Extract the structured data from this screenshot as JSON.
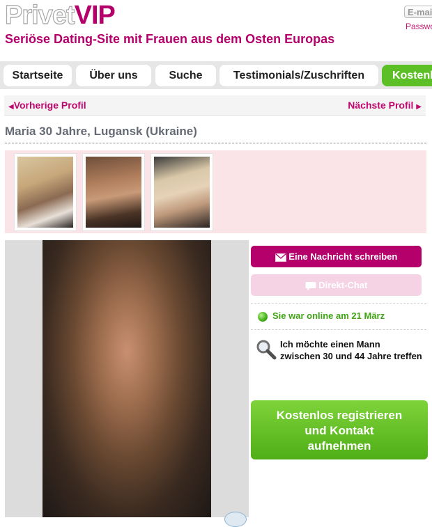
{
  "header": {
    "logo_part1": "Privet",
    "logo_part2": "VIP",
    "email_placeholder": "E-mail",
    "password_link": "Passwort",
    "tagline": "Seriöse Dating-Site mit Frauen aus dem Osten Europas"
  },
  "nav": {
    "tabs": [
      {
        "label": "Startseite"
      },
      {
        "label": "Über uns"
      },
      {
        "label": "Suche"
      },
      {
        "label": "Testimonials/Zuschriften"
      },
      {
        "label": "Kostenlos"
      }
    ]
  },
  "profile_nav": {
    "prev_label": "Vorherige Profil",
    "next_label": "Nächste Profil"
  },
  "profile": {
    "title": "Maria 30 Jahre, Lugansk (Ukraine)"
  },
  "actions": {
    "message_label": "Eine Nachricht schreiben",
    "chat_label": "Direkt-Chat",
    "online_status": "Sie war online am 21 März",
    "seeking_line1": "Ich möchte einen Mann",
    "seeking_line2": "zwischen 30 und 44 Jahre treffen",
    "register_line1": "Kostenlos registrieren",
    "register_line2": "und Kontakt",
    "register_line3": "aufnehmen"
  },
  "icons": [
    "envelope-icon",
    "chat-bubble-icon",
    "online-dot-icon",
    "magnifier-icon",
    "triangle-left-icon",
    "triangle-right-icon"
  ],
  "colors": {
    "brand": "#b5006c",
    "green": "#5bbf25",
    "thumb_bg": "#fbe4e7",
    "chat_disabled": "#f5d3e5"
  }
}
